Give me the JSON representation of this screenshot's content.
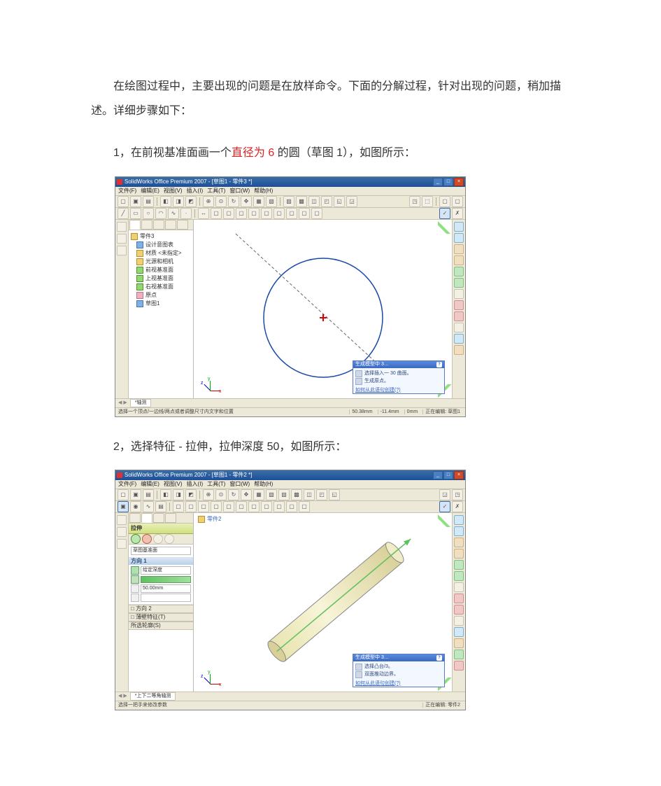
{
  "intro": "在绘图过程中，主要出现的问题是在放样命令。下面的分解过程，针对出现的问题，稍加描述。详细步骤如下：",
  "step1": {
    "prefix": "1，在前视基准面画一个",
    "red": "直径为 6",
    "suffix": " 的圆（草图 1），如图所示："
  },
  "step2": "2，选择特征 - 拉伸，拉伸深度 50，如图所示：",
  "app": {
    "title1": "SolidWorks Office Premium 2007 - [草图1 - 零件3 *]",
    "title2": "SolidWorks Office Premium 2007 - [草图1 - 零件2 *]",
    "menus": [
      "文件(F)",
      "编辑(E)",
      "视图(V)",
      "插入(I)",
      "工具(T)",
      "窗口(W)",
      "帮助(H)"
    ]
  },
  "tree1": {
    "root": "零件3",
    "items": [
      "设计意图表",
      "材质 <未指定>",
      "光源和相机",
      "前视基准面",
      "上视基准面",
      "右视基准面",
      "原点",
      "草图1"
    ]
  },
  "propExtrude": {
    "head": "拉伸",
    "secFrom": "草图基准面",
    "secDir": "方向 1",
    "dirType": "给定深度",
    "depth": "50.00mm",
    "secDir2": "方向 2",
    "thin": "薄壁特征(T)",
    "selContours": "所选轮廓(S)"
  },
  "popup1": {
    "title": "生成模型中 3…",
    "row1": "选择插入一 30 曲面。",
    "row2": "生成原点。",
    "link": "如何从此语句创建(?)"
  },
  "popup2": {
    "title": "生成模型中 3…",
    "row1": "选择凸台/3。",
    "row2": "双面推动边界。",
    "link": "如何从此语句创建(?)"
  },
  "status1": {
    "left": "选择一个顶点/一边线/两点或者调整尺寸内文字和位置",
    "mid": "50.38mm",
    "r1": "-11.4mm",
    "r2": "0mm",
    "r3": "正在编辑: 草图1"
  },
  "status2": {
    "left": "选择一把手来修改参数",
    "mid": "",
    "r1": "正在编辑: 零件2"
  },
  "tab1": "*轴测",
  "tab2": "*上下二等角轴测"
}
